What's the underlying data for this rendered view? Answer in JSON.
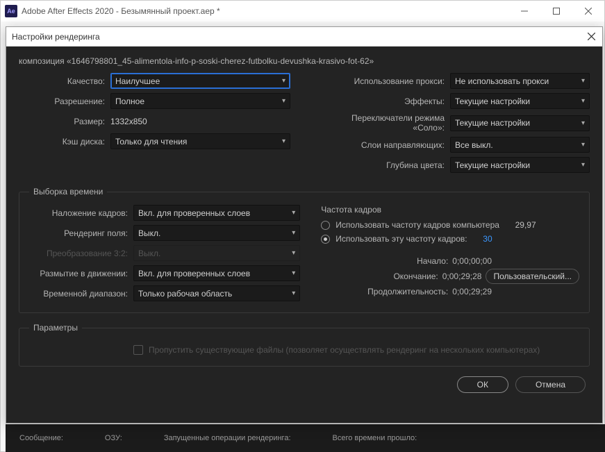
{
  "window": {
    "app_icon_text": "Ae",
    "title": "Adobe After Effects 2020 - Безымянный проект.aep *"
  },
  "dialog": {
    "title": "Настройки рендеринга"
  },
  "composition_label": "композиция «1646798801_45-alimentola-info-p-soski-cherez-futbolku-devushka-krasivo-fot-62»",
  "left": {
    "quality_label": "Качество:",
    "quality_value": "Наилучшее",
    "resolution_label": "Разрешение:",
    "resolution_value": "Полное",
    "size_label": "Размер:",
    "size_value": "1332x850",
    "diskcache_label": "Кэш диска:",
    "diskcache_value": "Только для чтения"
  },
  "right": {
    "proxy_label": "Использование прокси:",
    "proxy_value": "Не использовать прокси",
    "effects_label": "Эффекты:",
    "effects_value": "Текущие настройки",
    "solo_label": "Переключатели режима «Соло»:",
    "solo_value": "Текущие настройки",
    "guides_label": "Слои направляющих:",
    "guides_value": "Все выкл.",
    "depth_label": "Глубина цвета:",
    "depth_value": "Текущие настройки"
  },
  "time": {
    "legend": "Выборка времени",
    "blend_label": "Наложение кадров:",
    "blend_value": "Вкл. для проверенных слоев",
    "field_label": "Рендеринг поля:",
    "field_value": "Выкл.",
    "pulldown_label": "Преобразование 3:2:",
    "pulldown_value": "Выкл.",
    "motionblur_label": "Размытие в движении:",
    "motionblur_value": "Вкл. для проверенных слоев",
    "span_label": "Временной диапазон:",
    "span_value": "Только рабочая область",
    "framerate_head": "Частота кадров",
    "radio_comp_label": "Использовать частоту кадров компьютера",
    "radio_comp_value": "29,97",
    "radio_custom_label": "Использовать эту частоту кадров:",
    "radio_custom_value": "30",
    "start_label": "Начало:",
    "start_value": "0;00;00;00",
    "end_label": "Окончание:",
    "end_value": "0;00;29;28",
    "custom_btn": "Пользовательский...",
    "duration_label": "Продолжительность:",
    "duration_value": "0;00;29;29"
  },
  "params": {
    "legend": "Параметры",
    "skip_label": "Пропустить существующие файлы (позволяет осуществлять рендеринг на нескольких компьютерах)"
  },
  "footer": {
    "ok": "ОК",
    "cancel": "Отмена"
  },
  "status": {
    "msg": "Сообщение:",
    "ram": "ОЗУ:",
    "ops": "Запущенные операции рендеринга:",
    "elapsed": "Всего времени прошло:"
  }
}
